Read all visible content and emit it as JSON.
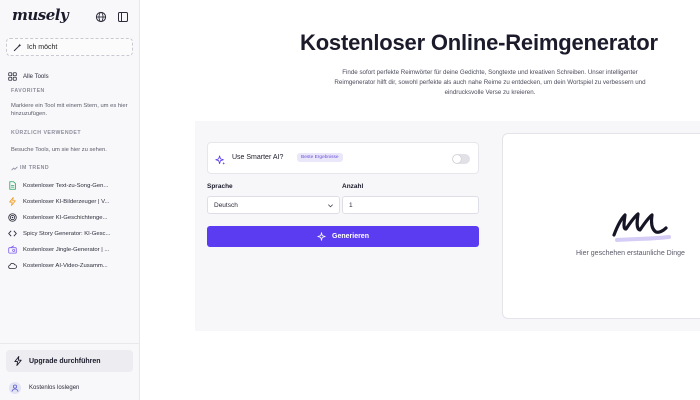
{
  "app": {
    "logo_text": "musely"
  },
  "sidebar": {
    "new_button_label": "Ich möcht",
    "all_tools_label": "Alle Tools",
    "favorites_heading": "FAVORITEN",
    "favorites_hint": "Markiere ein Tool mit einem Stern, um es hier hinzuzufügen.",
    "recent_heading": "KÜRZLICH VERWENDET",
    "recent_hint": "Besuche Tools, um sie hier zu sehen.",
    "trend_heading": "IM TREND",
    "trend_items": [
      {
        "label": "Kostenloser Text-zu-Song-Gen...",
        "icon": "document-icon",
        "color": "#22a35a"
      },
      {
        "label": "Kostenloser KI-Bilderzeuger | V...",
        "icon": "lightning-icon",
        "color": "#f29a1a"
      },
      {
        "label": "Kostenloser KI-Geschichtenge...",
        "icon": "target-icon",
        "color": "#2b2b3b"
      },
      {
        "label": "Spicy Story Generator: KI-Gesc...",
        "icon": "code-icon",
        "color": "#2b2b3b"
      },
      {
        "label": "Kostenloser Jingle-Generator | ...",
        "icon": "radio-icon",
        "color": "#7b5cf0"
      },
      {
        "label": "Kostenloser AI-Video-Zusamm...",
        "icon": "cloud-icon",
        "color": "#2b2b3b"
      }
    ],
    "upgrade_label": "Upgrade durchführen",
    "login_label": "Kostenlos loslegen"
  },
  "main": {
    "title": "Kostenloser Online-Reimgenerator",
    "subtitle": "Finde sofort perfekte Reimwörter für deine Gedichte, Songtexte und kreativen Schreiben. Unser intelligenter Reimgenerator hilft dir, sowohl perfekte als auch nahe Reime zu entdecken, um dein Wortspiel zu verbessern und eindrucksvolle Verse zu kreieren.",
    "smart_ai_label": "Use Smarter AI?",
    "smart_ai_badge": "Beste Ergebnisse",
    "smart_ai_enabled": false,
    "language_label": "Sprache",
    "language_value": "Deutsch",
    "count_label": "Anzahl",
    "count_value": "1",
    "generate_label": "Generieren",
    "result_placeholder": "Hier geschehen erstaunliche Dinge"
  },
  "colors": {
    "accent": "#5b3cf0",
    "badge_bg": "#ebe7fb",
    "badge_text": "#6b4fd8",
    "sidebar_bg": "#f8f8fa"
  }
}
